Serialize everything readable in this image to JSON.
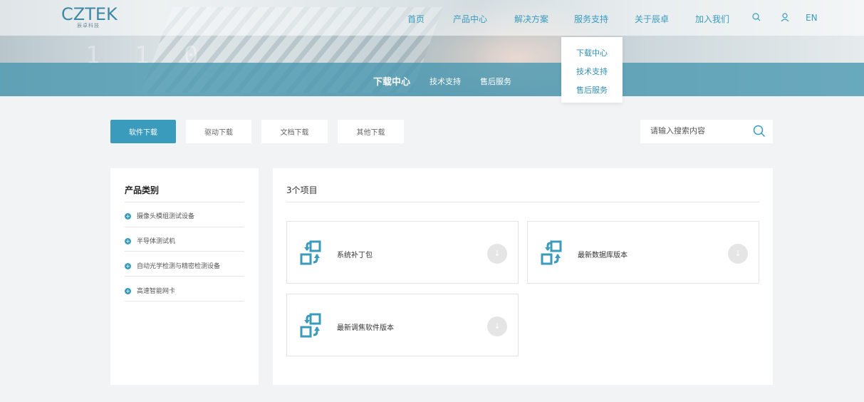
{
  "brand": {
    "logo_text": "CZTEK",
    "logo_sub": "辰卓科技"
  },
  "nav": {
    "items": [
      "首页",
      "产品中心",
      "解决方案",
      "服务支持",
      "关于辰卓",
      "加入我们"
    ],
    "lang": "EN"
  },
  "dropdown": {
    "items": [
      "下载中心",
      "技术支持",
      "售后服务"
    ]
  },
  "hero": {
    "digits": "1 1 0",
    "subnav": [
      "下载中心",
      "技术支持",
      "售后服务"
    ]
  },
  "tabs": [
    "软件下载",
    "驱动下载",
    "文档下载",
    "其他下载"
  ],
  "search": {
    "placeholder": "请输入搜索内容"
  },
  "sidebar": {
    "title": "产品类别",
    "items": [
      "摄像头模组测试设备",
      "半导体测试机",
      "自动光学检测与精密检测设备",
      "高速智能网卡"
    ]
  },
  "content": {
    "count": "3个项目",
    "files": [
      "系统补丁包",
      "最新数据库版本",
      "最新调焦软件版本"
    ]
  },
  "colors": {
    "accent": "#3a9bbd",
    "band": "#4696af"
  }
}
